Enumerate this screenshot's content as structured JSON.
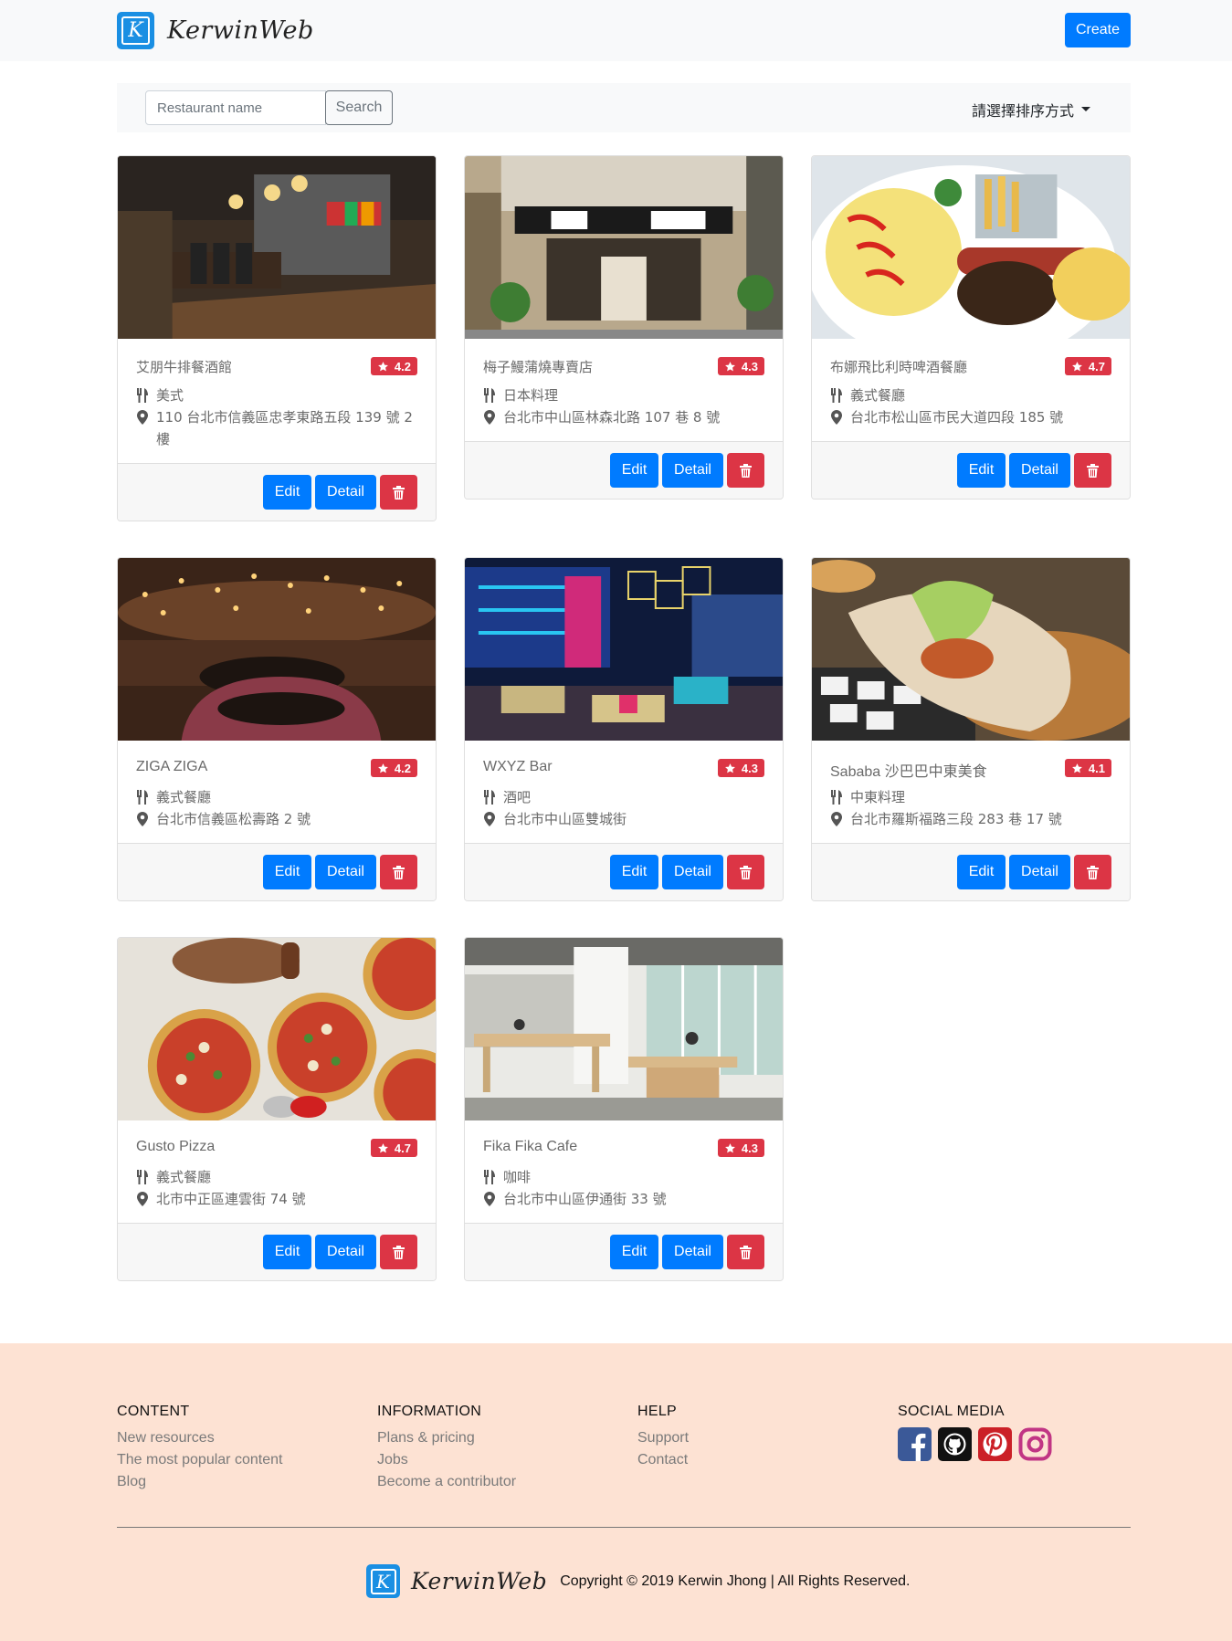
{
  "navbar": {
    "logo_letter": "K",
    "brand": "KerwinWeb",
    "create_label": "Create"
  },
  "search": {
    "placeholder": "Restaurant name",
    "button_label": "Search",
    "sort_label": "請選擇排序方式"
  },
  "card_buttons": {
    "edit": "Edit",
    "detail": "Detail"
  },
  "restaurants": [
    {
      "name": "艾朋牛排餐酒館",
      "rating": "4.2",
      "category": "美式",
      "address": "110 台北市信義區忠孝東路五段 139 號 2 樓"
    },
    {
      "name": "梅子鰻蒲燒專賣店",
      "rating": "4.3",
      "category": "日本料理",
      "address": "台北市中山區林森北路 107 巷 8 號"
    },
    {
      "name": "布娜飛比利時啤酒餐廳",
      "rating": "4.7",
      "category": "義式餐廳",
      "address": "台北市松山區市民大道四段 185 號"
    },
    {
      "name": "ZIGA ZIGA",
      "rating": "4.2",
      "category": "義式餐廳",
      "address": "台北市信義區松壽路 2 號"
    },
    {
      "name": "WXYZ Bar",
      "rating": "4.3",
      "category": "酒吧",
      "address": "台北市中山區雙城街"
    },
    {
      "name": "Sababa 沙巴巴中東美食",
      "rating": "4.1",
      "category": "中東料理",
      "address": "台北市羅斯福路三段 283 巷 17 號"
    },
    {
      "name": "Gusto Pizza",
      "rating": "4.7",
      "category": "義式餐廳",
      "address": "北市中正區連雲街 74 號"
    },
    {
      "name": "Fika Fika Cafe",
      "rating": "4.3",
      "category": "咖啡",
      "address": "台北市中山區伊通街 33 號"
    }
  ],
  "footer": {
    "columns": [
      {
        "title": "CONTENT",
        "links": [
          "New resources",
          "The most popular content",
          "Blog"
        ]
      },
      {
        "title": "INFORMATION",
        "links": [
          "Plans & pricing",
          "Jobs",
          "Become a contributor"
        ]
      },
      {
        "title": "HELP",
        "links": [
          "Support",
          "Contact"
        ]
      }
    ],
    "social_title": "SOCIAL MEDIA",
    "social_icons": [
      "facebook-icon",
      "github-icon",
      "pinterest-icon",
      "instagram-icon"
    ],
    "brand": "KerwinWeb",
    "copyright": "Copyright © 2019 Kerwin Jhong | All Rights Reserved."
  },
  "colors": {
    "primary": "#007bff",
    "danger": "#dc3545",
    "navbar_bg": "#f8f9fa",
    "footer_bg": "#fde2d3",
    "facebook": "#3b5998",
    "pinterest": "#cb2027",
    "instagram": "#c13584"
  }
}
